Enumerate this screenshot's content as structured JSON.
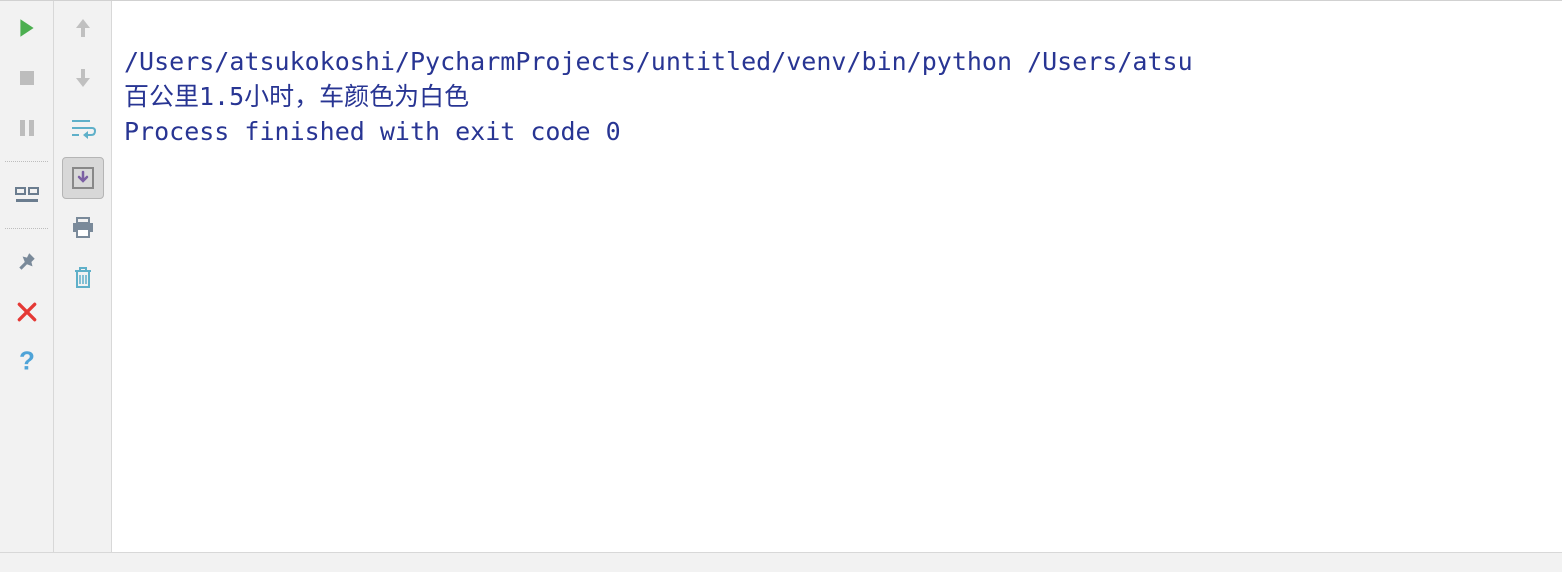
{
  "toolbar": {
    "col1": {
      "run": "run",
      "stop": "stop",
      "pause": "pause",
      "layout": "layout",
      "pin": "pin",
      "close": "close",
      "help": "help"
    },
    "col2": {
      "up": "up",
      "down": "down",
      "wrap": "wrap",
      "scroll_to_end": "scroll-to-end",
      "print": "print",
      "clear": "clear"
    }
  },
  "console": {
    "line1": "/Users/atsukokoshi/PycharmProjects/untitled/venv/bin/python /Users/atsu",
    "line2": "百公里1.5小时，车颜色为白色",
    "line3": "",
    "line4": "Process finished with exit code 0"
  }
}
